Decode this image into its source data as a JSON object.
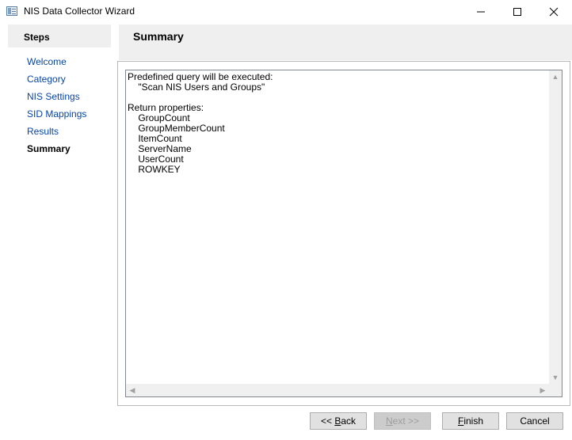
{
  "window": {
    "title": "NIS Data Collector Wizard"
  },
  "steps": {
    "header": "Steps",
    "items": [
      {
        "label": "Welcome",
        "current": false
      },
      {
        "label": "Category",
        "current": false
      },
      {
        "label": "NIS Settings",
        "current": false
      },
      {
        "label": "SID Mappings",
        "current": false
      },
      {
        "label": "Results",
        "current": false
      },
      {
        "label": "Summary",
        "current": true
      }
    ]
  },
  "content": {
    "title": "Summary",
    "lines": [
      "Predefined query will be executed:",
      "    \"Scan NIS Users and Groups\"",
      "",
      "Return properties:",
      "    GroupCount",
      "    GroupMemberCount",
      "    ItemCount",
      "    ServerName",
      "    UserCount",
      "    ROWKEY"
    ]
  },
  "buttons": {
    "back": {
      "prefix": "<< ",
      "mnemonic": "B",
      "rest": "ack",
      "enabled": true
    },
    "next": {
      "mnemonic": "N",
      "rest": "ext >>",
      "enabled": false
    },
    "finish": {
      "mnemonic": "F",
      "rest": "inish",
      "enabled": true
    },
    "cancel": {
      "label": "Cancel",
      "enabled": true
    }
  },
  "colors": {
    "step_link": "#0645ad",
    "header_bg": "#efefef",
    "button_bg": "#e1e1e1"
  }
}
